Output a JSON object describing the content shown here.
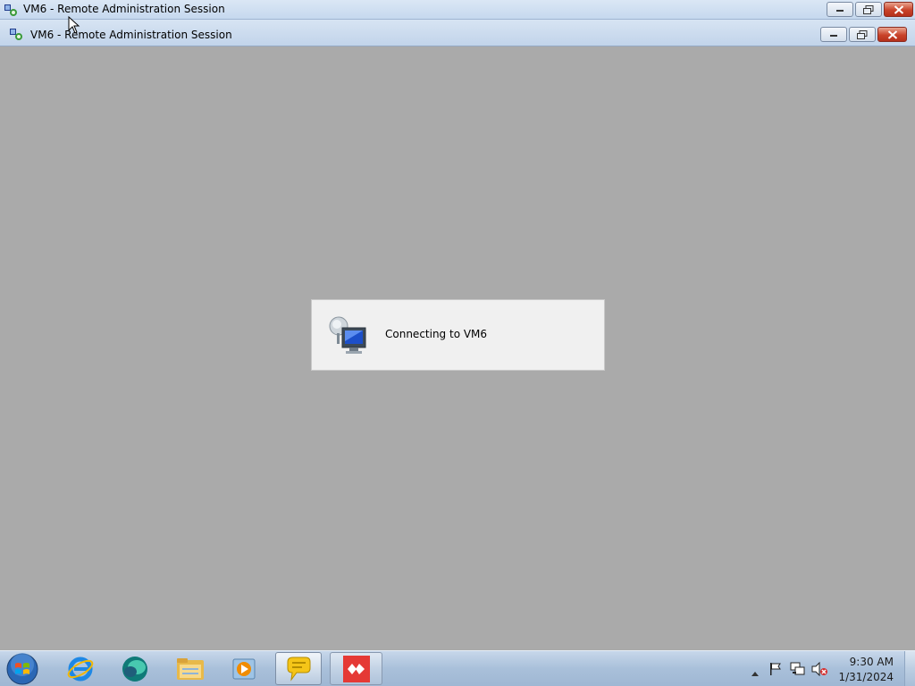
{
  "outer_window": {
    "title": "VM6 - Remote Administration Session",
    "icon": "remote-admin-icon",
    "buttons": [
      "minimize",
      "restore",
      "close"
    ]
  },
  "inner_window": {
    "title": "VM6 - Remote Administration Session",
    "icon": "remote-admin-icon",
    "buttons": [
      "minimize",
      "restore",
      "close"
    ]
  },
  "dialog": {
    "message": "Connecting to VM6",
    "icon": "network-computer-icon"
  },
  "taskbar": {
    "start_icon": "windows-start-icon",
    "pinned": [
      {
        "name": "internet-explorer-icon"
      },
      {
        "name": "remote-admin-app-icon"
      },
      {
        "name": "file-explorer-icon"
      },
      {
        "name": "media-player-icon"
      },
      {
        "name": "chat-bubble-icon",
        "state": "active"
      },
      {
        "name": "anydesk-icon",
        "state": "running"
      }
    ],
    "tray": {
      "icons": [
        "show-hidden-icons-chevron",
        "action-center-flag-icon",
        "network-icon",
        "volume-muted-icon"
      ],
      "time": "9:30 AM",
      "date": "1/31/2024"
    }
  },
  "colors": {
    "desktop_background": "#aaaaaa",
    "dialog_background": "#f0f0f0",
    "taskbar": "#a9c0da",
    "titlebar": "#c6d8ee",
    "close_button": "#c9432a",
    "anydesk_red": "#e53935"
  }
}
